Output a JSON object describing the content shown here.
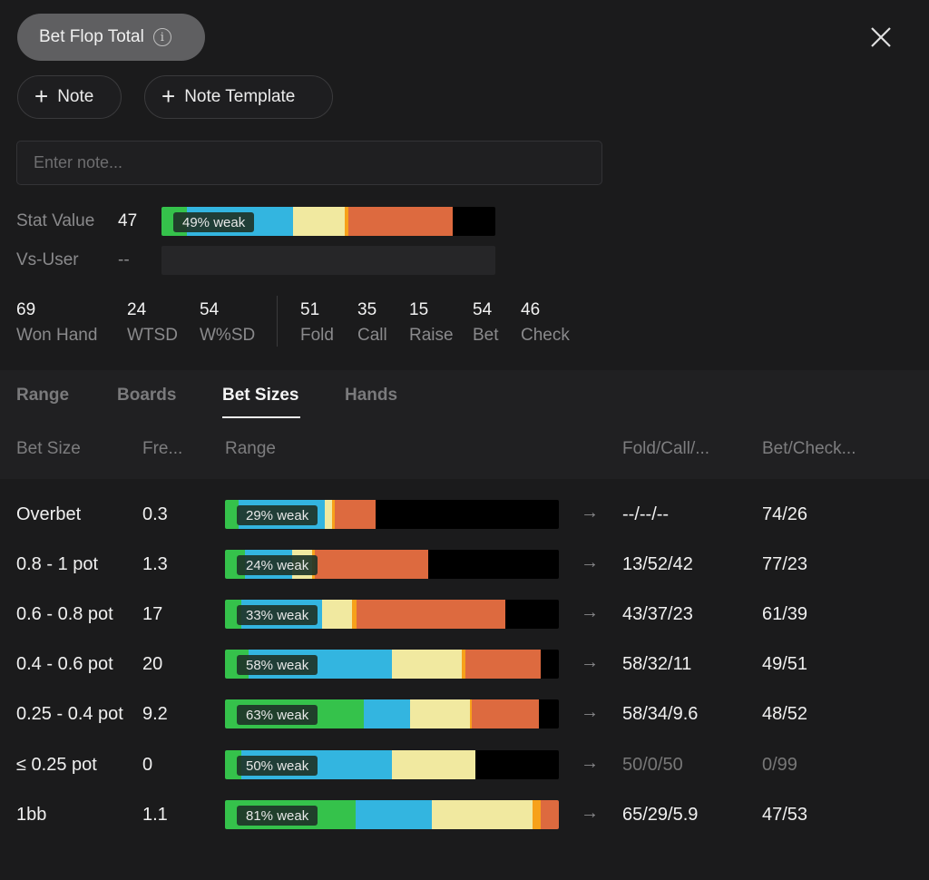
{
  "header": {
    "title": "Bet Flop Total",
    "info_icon": "info-icon",
    "close_icon": "close-icon"
  },
  "actions": {
    "note_label": "Note",
    "template_label": "Note Template"
  },
  "note_input": {
    "placeholder": "Enter note...",
    "value": ""
  },
  "stat_value": {
    "label": "Stat Value",
    "value": "47",
    "bar_tag": "49% weak",
    "bar_segments": [
      {
        "color": "#35c24b",
        "fraction": 0.075
      },
      {
        "color": "#33b5e0",
        "fraction": 0.32
      },
      {
        "color": "#f1e9a0",
        "fraction": 0.153
      },
      {
        "color": "#f7a11a",
        "fraction": 0.012
      },
      {
        "color": "#dd6a3f",
        "fraction": 0.312
      }
    ]
  },
  "vs_user": {
    "label": "Vs-User",
    "value": "--"
  },
  "stats": [
    {
      "value": "69",
      "label": "Won Hand"
    },
    {
      "value": "24",
      "label": "WTSD"
    },
    {
      "value": "54",
      "label": "W%SD"
    },
    {
      "value": "51",
      "label": "Fold"
    },
    {
      "value": "35",
      "label": "Call"
    },
    {
      "value": "15",
      "label": "Raise"
    },
    {
      "value": "54",
      "label": "Bet"
    },
    {
      "value": "46",
      "label": "Check"
    }
  ],
  "tabs": [
    {
      "label": "Range",
      "active": false
    },
    {
      "label": "Boards",
      "active": false
    },
    {
      "label": "Bet Sizes",
      "active": true
    },
    {
      "label": "Hands",
      "active": false
    }
  ],
  "columns": [
    "Bet Size",
    "Fre...",
    "Range",
    "Fold/Call/...",
    "Bet/Check..."
  ],
  "rows": [
    {
      "size": "Overbet",
      "freq": "0.3",
      "tag": "29% weak",
      "fcr": "--/--/--",
      "bc": "74/26",
      "segments": [
        {
          "color": "#35c24b",
          "fraction": 0.04
        },
        {
          "color": "#33b5e0",
          "fraction": 0.26
        },
        {
          "color": "#f1e9a0",
          "fraction": 0.02
        },
        {
          "color": "#f7a11a",
          "fraction": 0.01
        },
        {
          "color": "#dd6a3f",
          "fraction": 0.12
        }
      ]
    },
    {
      "size": "0.8 - 1 pot",
      "freq": "1.3",
      "tag": "24% weak",
      "fcr": "13/52/42",
      "bc": "77/23",
      "segments": [
        {
          "color": "#35c24b",
          "fraction": 0.06
        },
        {
          "color": "#33b5e0",
          "fraction": 0.14
        },
        {
          "color": "#f1e9a0",
          "fraction": 0.06
        },
        {
          "color": "#f7a11a",
          "fraction": 0.01
        },
        {
          "color": "#dd6a3f",
          "fraction": 0.34
        }
      ]
    },
    {
      "size": "0.6 - 0.8 pot",
      "freq": "17",
      "tag": "33% weak",
      "fcr": "43/37/23",
      "bc": "61/39",
      "segments": [
        {
          "color": "#35c24b",
          "fraction": 0.05
        },
        {
          "color": "#33b5e0",
          "fraction": 0.24
        },
        {
          "color": "#f1e9a0",
          "fraction": 0.09
        },
        {
          "color": "#f7a11a",
          "fraction": 0.015
        },
        {
          "color": "#dd6a3f",
          "fraction": 0.445
        }
      ]
    },
    {
      "size": "0.4 - 0.6 pot",
      "freq": "20",
      "tag": "58% weak",
      "fcr": "58/32/11",
      "bc": "49/51",
      "segments": [
        {
          "color": "#35c24b",
          "fraction": 0.07
        },
        {
          "color": "#33b5e0",
          "fraction": 0.43
        },
        {
          "color": "#f1e9a0",
          "fraction": 0.21
        },
        {
          "color": "#f7a11a",
          "fraction": 0.01
        },
        {
          "color": "#dd6a3f",
          "fraction": 0.225
        }
      ]
    },
    {
      "size": "0.25 - 0.4 pot",
      "freq": "9.2",
      "tag": "63% weak",
      "fcr": "58/34/9.6",
      "bc": "48/52",
      "segments": [
        {
          "color": "#35c24b",
          "fraction": 0.415
        },
        {
          "color": "#33b5e0",
          "fraction": 0.14
        },
        {
          "color": "#f1e9a0",
          "fraction": 0.18
        },
        {
          "color": "#f7a11a",
          "fraction": 0.005
        },
        {
          "color": "#dd6a3f",
          "fraction": 0.2
        }
      ]
    },
    {
      "size": "≤ 0.25 pot",
      "freq": "0",
      "tag": "50% weak",
      "fcr": "50/0/50",
      "bc": "0/99",
      "dim": true,
      "segments": [
        {
          "color": "#35c24b",
          "fraction": 0.05
        },
        {
          "color": "#33b5e0",
          "fraction": 0.45
        },
        {
          "color": "#f1e9a0",
          "fraction": 0.25
        }
      ]
    },
    {
      "size": "1bb",
      "freq": "1.1",
      "tag": "81% weak",
      "fcr": "65/29/5.9",
      "bc": "47/53",
      "segments": [
        {
          "color": "#35c24b",
          "fraction": 0.39
        },
        {
          "color": "#33b5e0",
          "fraction": 0.23
        },
        {
          "color": "#f1e9a0",
          "fraction": 0.3
        },
        {
          "color": "#f7a11a",
          "fraction": 0.025
        },
        {
          "color": "#dd6a3f",
          "fraction": 0.055
        }
      ]
    }
  ]
}
